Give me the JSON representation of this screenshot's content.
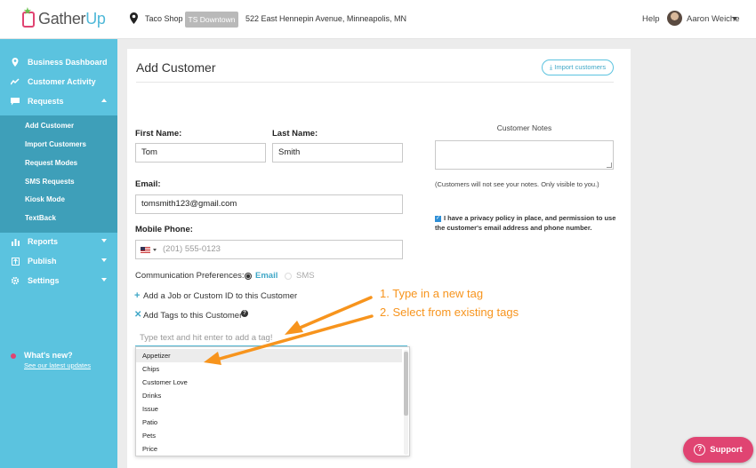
{
  "brand": {
    "logo_part1": "Gather",
    "logo_part2": "Up"
  },
  "header": {
    "location_name": "Taco Shop",
    "location_tag": "TS Downtown",
    "location_address": "522 East Hennepin Avenue, Minneapolis, MN",
    "help_label": "Help",
    "user_name": "Aaron Weiche"
  },
  "sidebar": {
    "items": [
      {
        "label": "Business Dashboard",
        "icon": "map-pin-icon"
      },
      {
        "label": "Customer Activity",
        "icon": "activity-icon"
      },
      {
        "label": "Requests",
        "icon": "message-icon"
      },
      {
        "label": "Reports",
        "icon": "bar-chart-icon"
      },
      {
        "label": "Publish",
        "icon": "publish-icon"
      },
      {
        "label": "Settings",
        "icon": "gear-icon"
      }
    ],
    "sub_items": [
      "Add Customer",
      "Import Customers",
      "Request Modes",
      "SMS Requests",
      "Kiosk Mode",
      "TextBack"
    ],
    "whats_new_title": "What's new?",
    "whats_new_link": "See our latest updates"
  },
  "form": {
    "title": "Add Customer",
    "import_button": "Import customers",
    "first_name_label": "First Name:",
    "first_name_value": "Tom",
    "last_name_label": "Last Name:",
    "last_name_value": "Smith",
    "email_label": "Email:",
    "email_value": "tomsmith123@gmail.com",
    "phone_label": "Mobile Phone:",
    "phone_placeholder": "(201) 555-0123",
    "comm_label": "Communication Preferences:",
    "comm_email": "Email",
    "comm_sms": "SMS",
    "add_job_label": "Add a Job or Custom ID to this Customer",
    "add_tags_label": "Add Tags to this Customer",
    "help_glyph": "?",
    "tag_input_placeholder": "Type text and hit enter to add a tag!",
    "notes_title": "Customer Notes",
    "notes_hint": "(Customers will not see your notes. Only visible to you.)",
    "privacy_text": "I have a privacy policy in place, and permission to use the customer's email address and phone number."
  },
  "tag_options": [
    "Appetizer",
    "Chips",
    "Customer Love",
    "Drinks",
    "Issue",
    "Patio",
    "Pets",
    "Price"
  ],
  "annotations": {
    "step1": "1. Type in a new tag",
    "step2": "2. Select from existing tags"
  },
  "support_button": {
    "label": "Support",
    "glyph": "?"
  },
  "colors": {
    "sidebar": "#5bc3df",
    "sidebar_sub": "#3e9fb9",
    "accent_pink": "#e04472",
    "annotation_orange": "#f7941d",
    "link_blue": "#3fa7c7"
  }
}
